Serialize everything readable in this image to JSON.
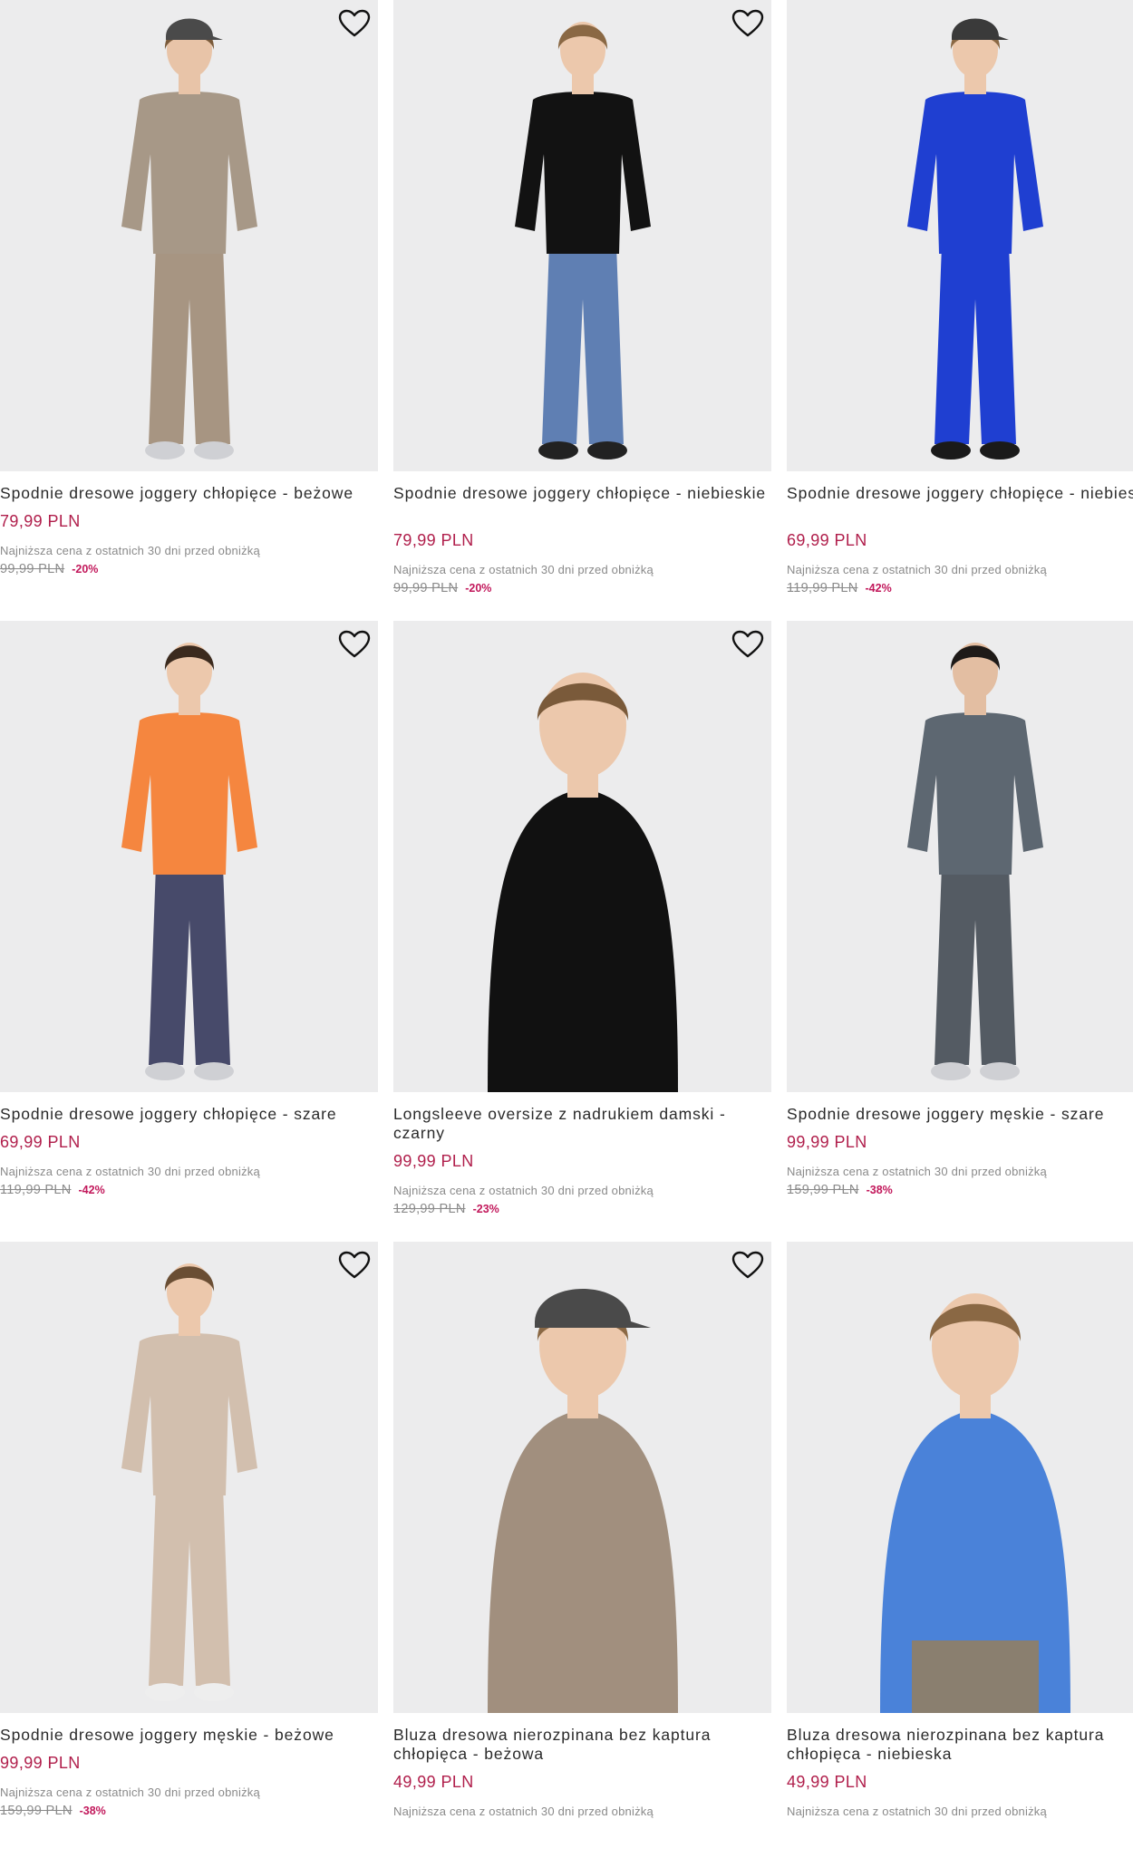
{
  "products": [
    {
      "title": "Spodnie dresowe joggery chłopięce - beżowe",
      "price": "79,99 PLN",
      "lowest_label": "Najniższa cena z ostatnich 30 dni przed obniżką",
      "old_price": "99,99 PLN",
      "discount": "-20%",
      "colors": {
        "top": "#a79887",
        "bottom": "#a79582",
        "skin": "#e8c4a8",
        "hair": "#7a5a3a",
        "cap": "#4a4a4a",
        "shoes": "#cfd0d4"
      }
    },
    {
      "title": "Spodnie dresowe joggery chłopięce - niebieskie",
      "price": "79,99 PLN",
      "lowest_label": "Najniższa cena z ostatnich 30 dni przed obniżką",
      "old_price": "99,99 PLN",
      "discount": "-20%",
      "colors": {
        "top": "#121212",
        "bottom": "#5f7fb3",
        "skin": "#ecc8ac",
        "hair": "#8a6844",
        "cap": "",
        "shoes": "#222222"
      }
    },
    {
      "title": "Spodnie dresowe joggery chłopięce - niebieskie",
      "price": "69,99 PLN",
      "lowest_label": "Najniższa cena z ostatnich 30 dni przed obniżką",
      "old_price": "119,99 PLN",
      "discount": "-42%",
      "colors": {
        "top": "#1f3fd1",
        "bottom": "#1f3fd1",
        "skin": "#ecc8ac",
        "hair": "#8a6844",
        "cap": "#3a3a3a",
        "shoes": "#1a1a1a"
      }
    },
    {
      "title": "Spodnie dresowe joggery chłopięce - szare",
      "price": "69,99 PLN",
      "lowest_label": "Najniższa cena z ostatnich 30 dni przed obniżką",
      "old_price": "119,99 PLN",
      "discount": "-42%",
      "colors": {
        "top": "#f5863f",
        "bottom": "#474a6a",
        "skin": "#ecc8ac",
        "hair": "#3b2a1e",
        "cap": "",
        "shoes": "#cfd0d4"
      }
    },
    {
      "title": "Longsleeve oversize z nadrukiem damski - czarny",
      "price": "99,99 PLN",
      "lowest_label": "Najniższa cena z ostatnich 30 dni przed obniżką",
      "old_price": "129,99 PLN",
      "discount": "-23%",
      "colors": {
        "top": "#111111",
        "bottom": "#111111",
        "skin": "#ecc8ac",
        "hair": "#7a5a3a",
        "cap": "",
        "shoes": ""
      }
    },
    {
      "title": "Spodnie dresowe joggery męskie - szare",
      "price": "99,99 PLN",
      "lowest_label": "Najniższa cena z ostatnich 30 dni przed obniżką",
      "old_price": "159,99 PLN",
      "discount": "-38%",
      "colors": {
        "top": "#5d6771",
        "bottom": "#545b63",
        "skin": "#e3bea2",
        "hair": "#1e1a18",
        "cap": "",
        "shoes": "#cfd0d4"
      }
    },
    {
      "title": "Spodnie dresowe joggery męskie - beżowe",
      "price": "99,99 PLN",
      "lowest_label": "Najniższa cena z ostatnich 30 dni przed obniżką",
      "old_price": "159,99 PLN",
      "discount": "-38%",
      "colors": {
        "top": "#d2bfae",
        "bottom": "#d2bfae",
        "skin": "#ecc8ac",
        "hair": "#6a4e34",
        "cap": "",
        "shoes": "#eeeeee"
      }
    },
    {
      "title": "Bluza dresowa nierozpinana bez kaptura chłopięca - beżowa",
      "price": "49,99 PLN",
      "lowest_label": "Najniższa cena z ostatnich 30 dni przed obniżką",
      "old_price": "",
      "discount": "",
      "colors": {
        "top": "#a18f7e",
        "bottom": "#a18f7e",
        "skin": "#ecc8ac",
        "hair": "#8a6844",
        "cap": "#4a4a4a",
        "shoes": ""
      }
    },
    {
      "title": "Bluza dresowa nierozpinana bez kaptura chłopięca - niebieska",
      "price": "49,99 PLN",
      "lowest_label": "Najniższa cena z ostatnich 30 dni przed obniżką",
      "old_price": "",
      "discount": "",
      "colors": {
        "top": "#4a82d9",
        "bottom": "#8a7f6f",
        "skin": "#ecc8ac",
        "hair": "#8a6844",
        "cap": "",
        "shoes": ""
      }
    }
  ]
}
